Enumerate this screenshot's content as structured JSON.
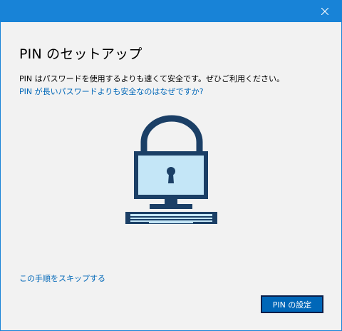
{
  "dialog": {
    "heading": "PIN のセットアップ",
    "description": "PIN はパスワードを使用するよりも速くて安全です。ぜひご利用ください。",
    "why_link": "PIN が長いパスワードよりも安全なのはなぜですか?",
    "skip_link": "この手順をスキップする",
    "primary_button": "PIN の設定"
  },
  "titlebar": {
    "close_icon": "close-icon"
  },
  "illustration": {
    "icon": "lock-computer-icon"
  },
  "colors": {
    "accent": "#1883d7",
    "link": "#0067b8",
    "button": "#0067b8",
    "illustration_dark": "#1b3f66",
    "illustration_light": "#c4e6f7",
    "background": "#f2f2f2"
  }
}
